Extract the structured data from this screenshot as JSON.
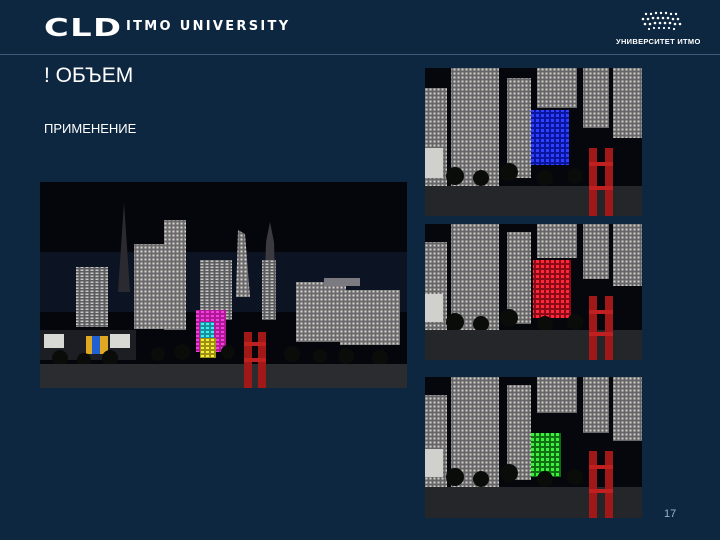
{
  "header": {
    "logo_cld": "CLD",
    "logo_itmo": "ITMO UNIVERSITY",
    "university_logo_text": "УНИВЕРСИТЕТ ИТМО"
  },
  "slide": {
    "title": "! ОБЪЕМ",
    "subtitle": "ПРИМЕНЕНИЕ",
    "page_number": "17"
  },
  "colors": {
    "background": "#0e2740",
    "text": "#ffffff",
    "highlight_blue": "#1a2ce8",
    "highlight_red": "#e01c2c",
    "highlight_green": "#2ec828",
    "highlight_magenta": "#e022c8",
    "highlight_cyan": "#22d8e0",
    "highlight_yellow": "#e8e020"
  },
  "images": [
    {
      "name": "city-scene-multicolor",
      "description_icon": "night-city-render-icon"
    },
    {
      "name": "city-scene-blue",
      "description_icon": "night-city-render-icon"
    },
    {
      "name": "city-scene-red",
      "description_icon": "night-city-render-icon"
    },
    {
      "name": "city-scene-green",
      "description_icon": "night-city-render-icon"
    }
  ]
}
